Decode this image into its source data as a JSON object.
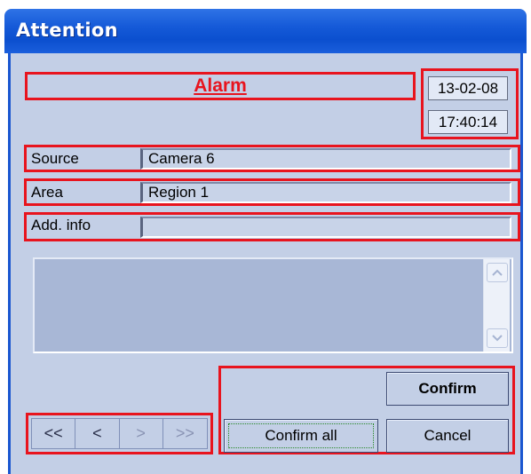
{
  "window": {
    "title": "Attention"
  },
  "header": {
    "event": "Alarm",
    "date": "13-02-08",
    "time": "17:40:14"
  },
  "fields": [
    {
      "label": "Source",
      "value": "Camera 6"
    },
    {
      "label": "Area",
      "value": "Region 1"
    },
    {
      "label": "Add. info",
      "value": ""
    }
  ],
  "message": {
    "text": ""
  },
  "scrollbar": {
    "up_icon": "scroll-up-arrow",
    "down_icon": "scroll-down-arrow"
  },
  "nav": {
    "first": "<<",
    "prev": "<",
    "next": ">",
    "last": ">>"
  },
  "actions": {
    "confirm": "Confirm",
    "confirm_all": "Confirm all",
    "cancel": "Cancel"
  },
  "colors": {
    "highlight": "#e8141e",
    "titlebar": "#155ad8",
    "panel": "#c3cfe6",
    "alarm_text": "#e8141e"
  }
}
